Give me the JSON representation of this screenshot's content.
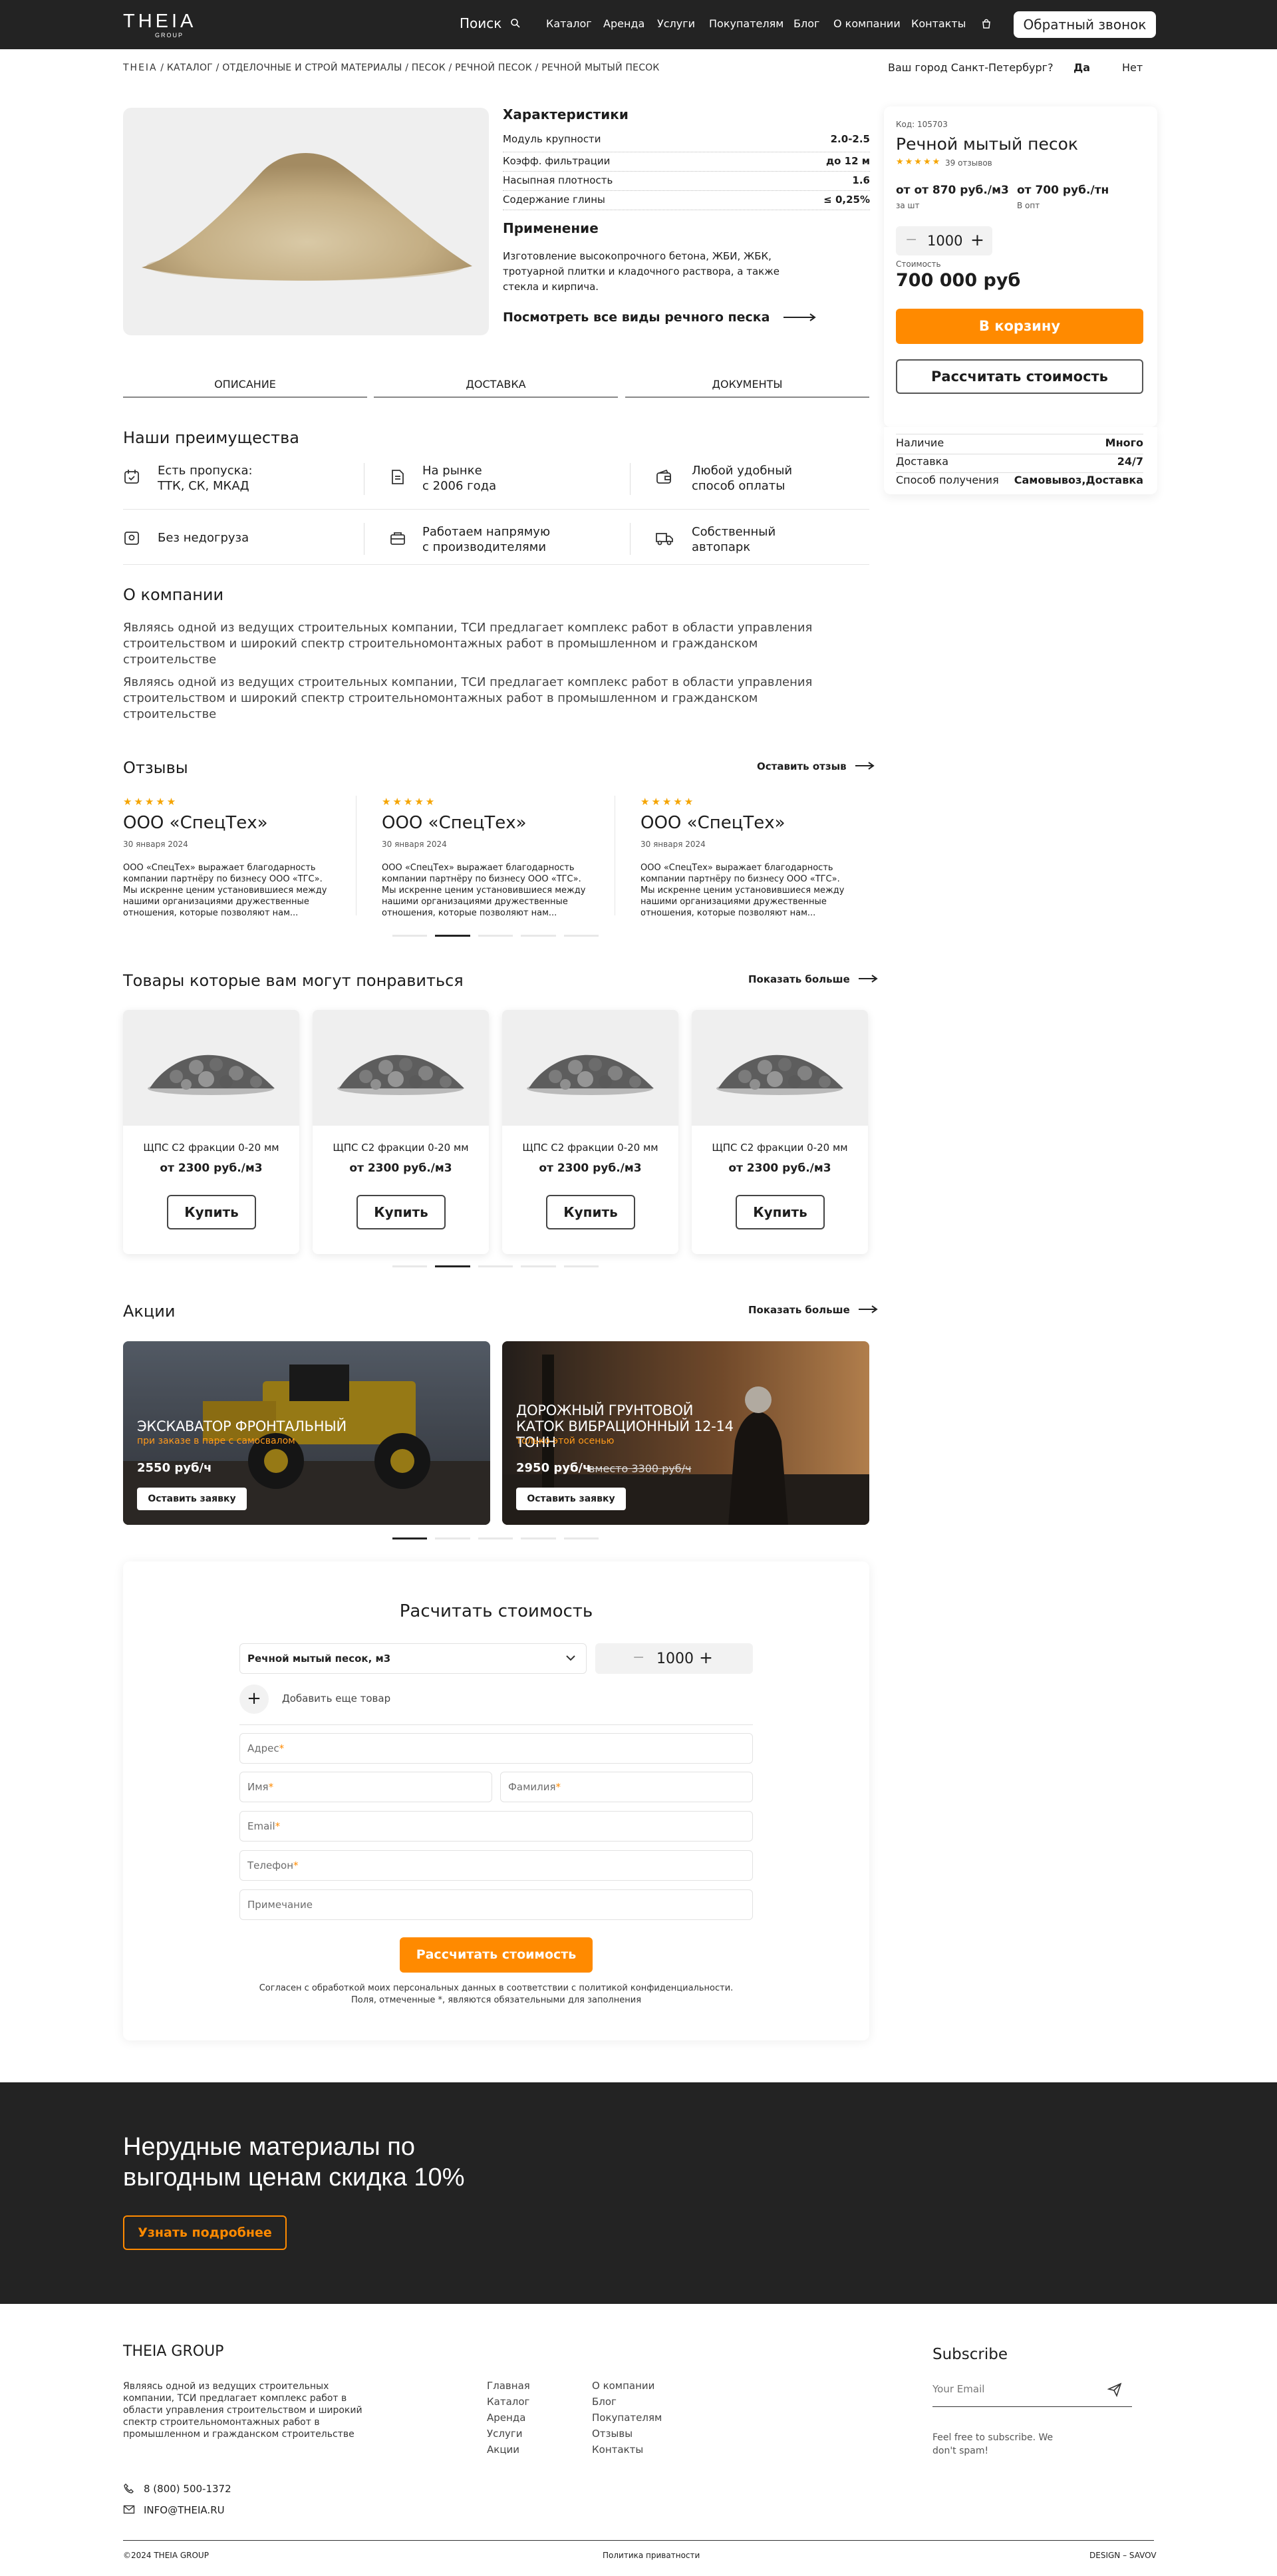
{
  "header": {
    "logo": "THEIA",
    "logo_sub": "GROUP",
    "search_label": "Поиск",
    "nav": [
      "Каталог",
      "Аренда",
      "Услуги",
      "Покупателям",
      "Блог",
      "О компании",
      "Контакты"
    ],
    "callback": "Обратный звонок"
  },
  "breadcrumb": {
    "items": [
      "THEIA",
      "КАТАЛОГ",
      "ОТДЕЛОЧНЫЕ И СТРОЙ МАТЕРИАЛЫ",
      "ПЕСОК",
      "РЕЧНОЙ ПЕСОК",
      "РЕЧНОЙ МЫТЫЙ ПЕСОК"
    ],
    "city_question": "Ваш город Санкт-Петербург?",
    "yes": "Да",
    "no": "Нет"
  },
  "product": {
    "chars_title": "Характеристики",
    "chars": [
      {
        "label": "Модуль крупности",
        "value": "2.0-2.5"
      },
      {
        "label": "Коэфф. фильтрации",
        "value": "до 12 м"
      },
      {
        "label": "Насыпная плотность",
        "value": "1.6"
      },
      {
        "label": "Содержание глины",
        "value": "≤ 0,25%"
      }
    ],
    "usage_title": "Применение",
    "usage_text": "Изготовление высокопрочного бетона, ЖБИ, ЖБК, тротуарной плитки и кладочного раствора, а также стекла и кирпича.",
    "all_link": "Посмотреть все виды речного песка"
  },
  "price_card": {
    "code": "Код: 105703",
    "title": "Речной мытый песок",
    "reviews": "39 отзывов",
    "rating": 5,
    "price1": "от от 870 руб./м3",
    "price1_sub": "за шт",
    "price2": "от 700 руб./тн",
    "price2_sub": "В опт",
    "qty": "1000",
    "cost_label": "Стоимость",
    "total": "700 000 руб",
    "cart_btn": "В корзину",
    "calc_btn": "Рассчитать стоимость"
  },
  "availability": [
    {
      "label": "Наличие",
      "value": "Много"
    },
    {
      "label": "Доставка",
      "value": "24/7"
    },
    {
      "label": "Способ получения",
      "value": "Самовывоз,Доставка"
    }
  ],
  "tabs": [
    "ОПИСАНИЕ",
    "ДОСТАВКА",
    "ДОКУМЕНТЫ"
  ],
  "advantages": {
    "title": "Наши преимущества",
    "items": [
      {
        "icon": "calendar-icon",
        "l1": "Есть пропуска:",
        "l2": "ТТК, СК, МКАД"
      },
      {
        "icon": "document-icon",
        "l1": "На рынке",
        "l2": "с 2006 года"
      },
      {
        "icon": "wallet-icon",
        "l1": "Любой удобный",
        "l2": "способ оплаты"
      },
      {
        "icon": "scale-icon",
        "l1": "Без недогруза",
        "l2": ""
      },
      {
        "icon": "handshake-icon",
        "l1": "Работаем напрямую",
        "l2": "с производителями"
      },
      {
        "icon": "truck-icon",
        "l1": "Собственный",
        "l2": "автопарк"
      }
    ]
  },
  "about": {
    "title": "О компании",
    "p1": "Являясь одной из ведущих строительных компании, ТСИ предлагает комплекс работ в области управления строительством и широкий спектр строительномонтажных работ в промышленном и гражданском строительстве",
    "p2": "Являясь одной из ведущих строительных компании, ТСИ предлагает комплекс работ в области управления строительством и широкий спектр строительномонтажных работ в промышленном и гражданском строительстве"
  },
  "reviews": {
    "title": "Отзывы",
    "leave": "Оставить отзыв",
    "items": [
      {
        "name": "ООО «СпецТех»",
        "date": "30 января 2024",
        "text": "ООО «СпецТех» выражает благодарность компании партнёру по бизнесу ООО «ТГС». Мы искренне ценим установившиеся между нашими организациями дружественные отношения, которые позволяют нам..."
      },
      {
        "name": "ООО «СпецТех»",
        "date": "30 января 2024",
        "text": "ООО «СпецТех» выражает благодарность компании партнёру по бизнесу ООО «ТГС». Мы искренне ценим установившиеся между нашими организациями дружественные отношения, которые позволяют нам..."
      },
      {
        "name": "ООО «СпецТех»",
        "date": "30 января 2024",
        "text": "ООО «СпецТех» выражает благодарность компании партнёру по бизнесу ООО «ТГС». Мы искренне ценим установившиеся между нашими организациями дружественные отношения, которые позволяют нам..."
      }
    ]
  },
  "recommend": {
    "title": "Товары которые вам могут понравиться",
    "more": "Показать больше",
    "items": [
      {
        "name": "ЩПС С2 фракции 0-20 мм",
        "price": "от 2300 руб./м3",
        "btn": "Купить"
      },
      {
        "name": "ЩПС С2 фракции 0-20 мм",
        "price": "от 2300 руб./м3",
        "btn": "Купить"
      },
      {
        "name": "ЩПС С2 фракции 0-20 мм",
        "price": "от 2300 руб./м3",
        "btn": "Купить"
      },
      {
        "name": "ЩПС С2 фракции 0-20 мм",
        "price": "от 2300 руб./м3",
        "btn": "Купить"
      }
    ]
  },
  "promos": {
    "title": "Акции",
    "more": "Показать больше",
    "items": [
      {
        "title": "ЭКСКАВАТОР ФРОНТАЛЬНЫЙ",
        "sub": "при заказе в паре с самосвалом",
        "price": "2550 руб/ч",
        "old": "",
        "btn": "Оставить заявку"
      },
      {
        "title": "ДОРОЖНЫЙ ГРУНТОВОЙ КАТОК ВИБРАЦИОННЫЙ 12-14 ТОНН",
        "sub": "только этой осенью",
        "price": "2950 руб/ч",
        "old": "вместо 3300 руб/ч",
        "btn": "Оставить заявку"
      }
    ]
  },
  "calc": {
    "title": "Расчитать стоимость",
    "select": "Речной мытый песок, м3",
    "qty": "1000",
    "add": "Добавить еще товар",
    "address": "Адрес",
    "name": "Имя",
    "surname": "Фамилия",
    "email": "Email",
    "phone": "Телефон",
    "note": "Примечание",
    "submit": "Рассчитать стоимость",
    "consent1": "Согласен с обработкой моих персональных данных в соответствии с политикой конфиденциальности.",
    "consent2": "Поля, отмеченные *, являются обязательными для заполнения"
  },
  "banner": {
    "line1": "Нерудные материалы по",
    "line2": "выгодным ценам скидка 10%",
    "btn": "Узнать подробнее"
  },
  "footer": {
    "brand": "THEIA GROUP",
    "text": "Являясь одной из ведущих строительных компании, ТСИ предлагает комплекс работ в области управления строительством и широкий спектр строительномонтажных работ в промышленном и гражданском строительстве",
    "col1": [
      "Главная",
      "Каталог",
      "Аренда",
      "Услуги",
      "Акции"
    ],
    "col2": [
      "О компании",
      "Блог",
      "Покупателям",
      "Отзывы",
      "Контакты"
    ],
    "subscribe": "Subscribe",
    "email_ph": "Your Email",
    "sub_text": "Feel free to subscribe. We don't spam!",
    "phone": "8 (800) 500-1372",
    "mail": "INFO@THEIA.RU",
    "copy": "©2024 THEIA GROUP",
    "policy": "Политика приватности",
    "design": "DESIGN – SAVOV"
  },
  "colors": {
    "accent": "#ff8a00",
    "dark": "#232323",
    "star": "#f5a400"
  }
}
